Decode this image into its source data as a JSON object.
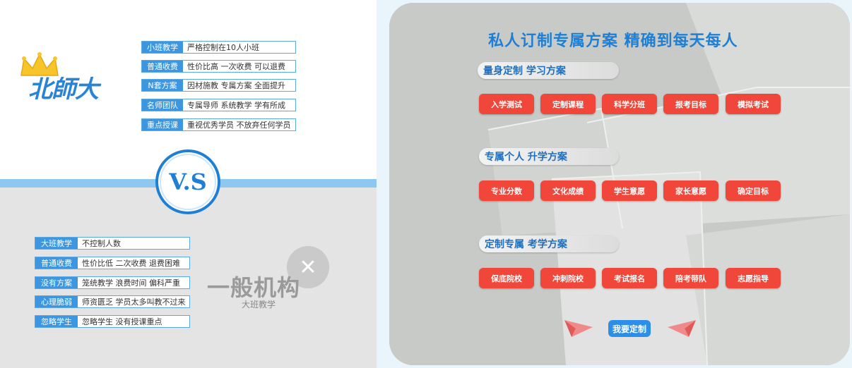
{
  "left_panel": {
    "logo_text": "北師大",
    "top_rows": [
      {
        "tag": "小班教学",
        "desc": "严格控制在10人小班"
      },
      {
        "tag": "普通收费",
        "desc": "性价比高  一次收费  可以退费"
      },
      {
        "tag": "N套方案",
        "desc": "因材施教 专属方案 全面提升"
      },
      {
        "tag": "名师团队",
        "desc": "专属导师 系统教学 学有所成"
      },
      {
        "tag": "重点授课",
        "desc": "重视优秀学员 不放弃任何学员"
      }
    ],
    "vs_label": "V.S",
    "bottom_rows": [
      {
        "tag": "大班教学",
        "desc": "不控制人数"
      },
      {
        "tag": "普通收费",
        "desc": "性价比低 二次收费 退费困难"
      },
      {
        "tag": "没有方案",
        "desc": "笼统教学 浪费时间 偏科严重"
      },
      {
        "tag": "心理脆弱",
        "desc": "师资匮乏 学员太多叫教不过来"
      },
      {
        "tag": "忽略学生",
        "desc": "忽略学生 没有授课重点"
      }
    ],
    "general_title": "一般机构",
    "general_subtitle": "大班教学",
    "x_mark": "✕"
  },
  "right_panel": {
    "title": "私人订制专属方案     精确到每天每人",
    "sections": [
      {
        "title": "量身定制  学习方案",
        "buttons": [
          "入学测试",
          "定制课程",
          "科学分班",
          "报考目标",
          "模拟考试"
        ]
      },
      {
        "title": "专属个人  升学方案",
        "buttons": [
          "专业分数",
          "文化成绩",
          "学生意愿",
          "家长意愿",
          "确定目标"
        ]
      },
      {
        "title": "定制专属  考学方案",
        "buttons": [
          "保底院校",
          "冲刺院校",
          "考试报名",
          "陪考带队",
          "志愿指导"
        ]
      }
    ],
    "cta_label": "我要定制"
  },
  "colors": {
    "accent_blue": "#1e7fd4",
    "button_red": "#f0473a"
  }
}
